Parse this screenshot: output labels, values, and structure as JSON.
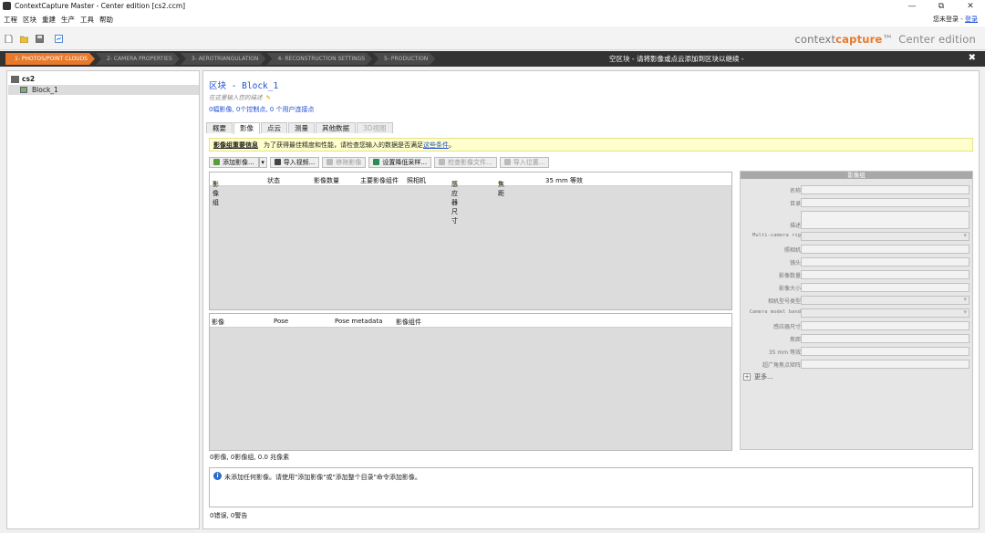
{
  "window": {
    "title": "ContextCapture Master - Center edition [cs2.ccm]"
  },
  "menu": {
    "items": [
      "工程",
      "区块",
      "重建",
      "生产",
      "工具",
      "帮助"
    ],
    "login_text": "您未登录 - ",
    "login_link": "登录"
  },
  "brand": {
    "context": "context",
    "capture": "capture",
    "tm": "™",
    "edition": "Center edition"
  },
  "workflow": {
    "steps": [
      "1- PHOTOS/POINT CLOUDS",
      "2- CAMERA PROPERTIES",
      "3- AEROTRIANGULATION",
      "4- RECONSTRUCTION SETTINGS",
      "5- PRODUCTION"
    ],
    "message": "空区块 - 请将影像或点云添加到区块以继续 -"
  },
  "tree": {
    "root": "cs2",
    "child": "Block_1"
  },
  "block": {
    "title": "区块 - Block_1",
    "description": "在这里输入您的描述",
    "summary": "0幅影像, 0个控制点, 0 个用户连接点"
  },
  "tabs": [
    "概要",
    "影像",
    "点云",
    "测量",
    "其他数据",
    "3D视图"
  ],
  "notice": {
    "title": "影像组重要信息",
    "text": "为了获得最佳精度和性能，请检查您输入的数据是否满足",
    "link": "这些条件",
    "end": "。"
  },
  "buttons": {
    "add_images": "添加影像...",
    "import_video": "导入视频...",
    "remove_images": "移除影像",
    "set_downsample": "设置降低采样...",
    "check_files": "检查影像文件...",
    "import_positions": "导入位置..."
  },
  "upper_table": {
    "columns": [
      "影像组",
      "状态",
      "影像数量",
      "主要影像组件",
      "照相机",
      "感应器尺寸",
      "焦距",
      "35 mm 等效"
    ]
  },
  "lower_table": {
    "columns": [
      "影像",
      "Pose",
      "Pose metadata",
      "影像组件"
    ]
  },
  "status": {
    "counts": "0影像, 0影像组, 0.0 兆像素",
    "errors": "0错误, 0警告"
  },
  "log": {
    "message": "未添加任何影像。请使用\"添加影像\"或\"添加整个目录\"命令添加影像。"
  },
  "properties": {
    "header": "影像组",
    "rows": [
      "名称",
      "目录",
      "描述",
      "Multi-camera rig",
      "照相机",
      "镜头",
      "影像数量",
      "影像大小",
      "相机型号类型",
      "Camera model band",
      "感应器尺寸",
      "焦距",
      "35 mm 等效",
      "超广角焦点矩阵"
    ],
    "more": "更多..."
  }
}
